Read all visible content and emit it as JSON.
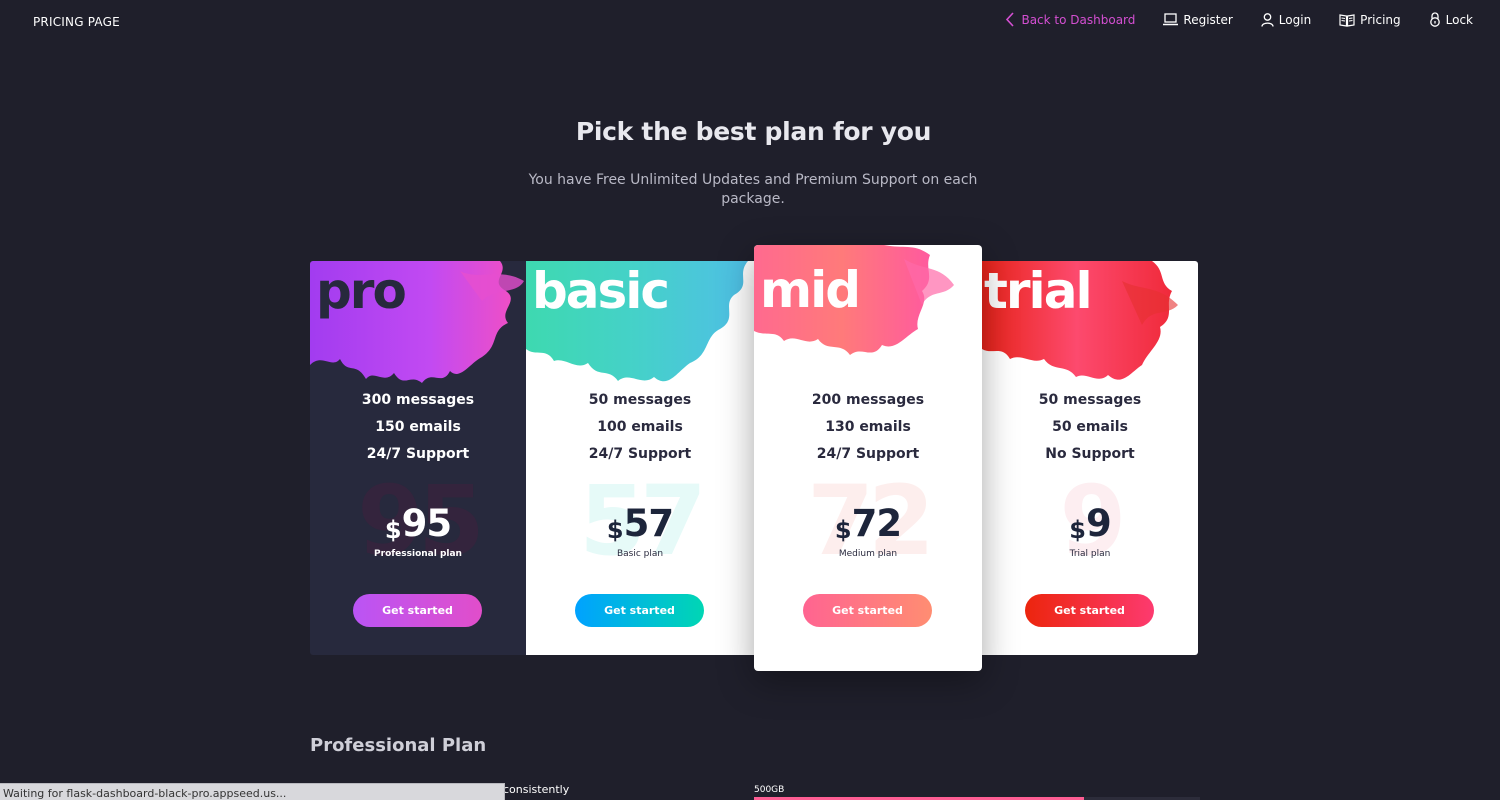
{
  "navbar": {
    "brand": "PRICING PAGE",
    "links": [
      {
        "icon": "chevron-left-icon",
        "label": "Back to Dashboard",
        "color": "#d44fd2"
      },
      {
        "icon": "laptop-icon",
        "label": "Register"
      },
      {
        "icon": "user-icon",
        "label": "Login"
      },
      {
        "icon": "book-icon",
        "label": "Pricing"
      },
      {
        "icon": "lock-icon",
        "label": "Lock"
      }
    ]
  },
  "header": {
    "title": "Pick the best plan for you",
    "subtitle": "You have Free Unlimited Updates and Premium Support on each package."
  },
  "plans": [
    {
      "name": "pro",
      "features": [
        "300 messages",
        "150 emails",
        "24/7 Support"
      ],
      "currency": "$",
      "price": "95",
      "description": "Professional plan",
      "button": "Get started",
      "accent": "#ba54f5"
    },
    {
      "name": "basic",
      "features": [
        "50 messages",
        "100 emails",
        "24/7 Support"
      ],
      "currency": "$",
      "price": "57",
      "description": "Basic plan",
      "button": "Get started",
      "accent": "#00d6b4"
    },
    {
      "name": "mid",
      "features": [
        "200 messages",
        "130 emails",
        "24/7 Support"
      ],
      "currency": "$",
      "price": "72",
      "description": "Medium plan",
      "button": "Get started",
      "accent": "#ff6491"
    },
    {
      "name": "trial",
      "features": [
        "50 messages",
        "50 emails",
        "No Support"
      ],
      "currency": "$",
      "price": "9",
      "description": "Trial plan",
      "button": "Get started",
      "accent": "#ec250d"
    }
  ],
  "details": {
    "section_title": "Professional Plan",
    "partial_text": "consistently",
    "storage_label": "500GB",
    "storage_progress": 0.74
  },
  "status_bar": "Waiting for flask-dashboard-black-pro.appseed.us..."
}
